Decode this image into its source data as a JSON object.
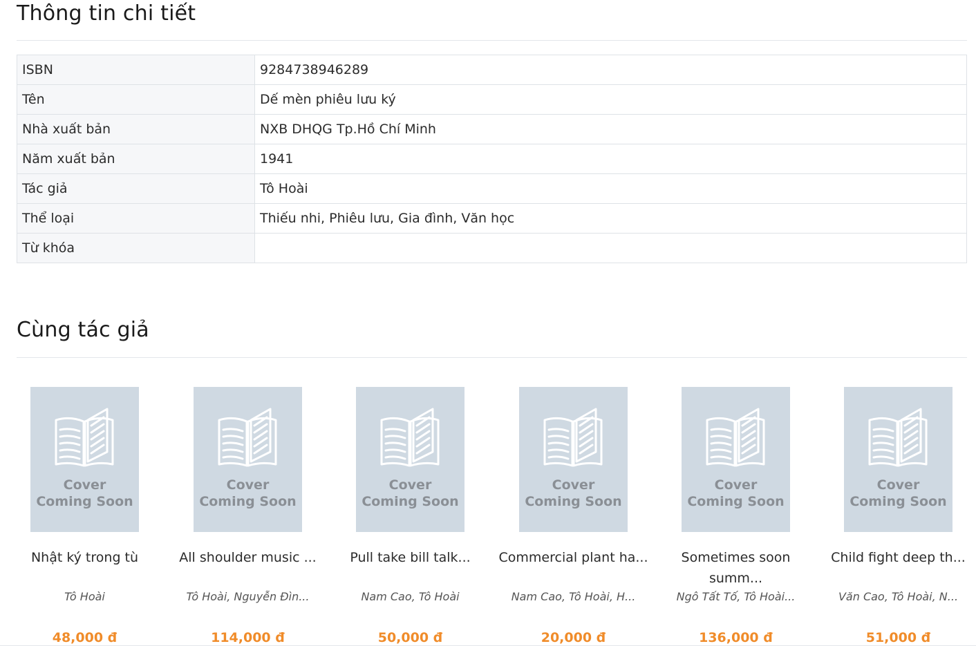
{
  "details": {
    "heading": "Thông tin chi tiết",
    "rows": [
      {
        "key": "ISBN",
        "value": "9284738946289"
      },
      {
        "key": "Tên",
        "value": "Dế mèn phiêu lưu ký"
      },
      {
        "key": "Nhà xuất bản",
        "value": "NXB DHQG Tp.Hồ Chí Minh"
      },
      {
        "key": "Năm xuất bản",
        "value": "1941"
      },
      {
        "key": "Tác giả",
        "value": "Tô Hoài"
      },
      {
        "key": "Thể loại",
        "value": "Thiếu nhi, Phiêu lưu, Gia đình, Văn học"
      },
      {
        "key": "Từ khóa",
        "value": ""
      }
    ]
  },
  "related": {
    "heading": "Cùng tác giả",
    "cover_line1": "Cover",
    "cover_line2": "Coming Soon",
    "books": [
      {
        "title": "Nhật ký trong tù",
        "authors": "Tô Hoài",
        "price": "48,000 đ"
      },
      {
        "title": "All shoulder music ...",
        "authors": "Tô Hoài, Nguyễn Đìn...",
        "price": "114,000 đ"
      },
      {
        "title": "Pull take bill talk...",
        "authors": "Nam Cao, Tô Hoài",
        "price": "50,000 đ"
      },
      {
        "title": "Commercial plant ha...",
        "authors": "Nam Cao, Tô Hoài, H...",
        "price": "20,000 đ"
      },
      {
        "title": "Sometimes soon summ...",
        "authors": "Ngô Tất Tố, Tô Hoài...",
        "price": "136,000 đ"
      },
      {
        "title": "Child fight deep th...",
        "authors": "Văn Cao, Tô Hoài, N...",
        "price": "51,000 đ"
      }
    ]
  },
  "colors": {
    "price": "#f08c2a",
    "cover_bg": "#cfd9e2",
    "cover_icon": "#ffffff"
  },
  "icons": {
    "cover_icon": "open-book-icon"
  }
}
